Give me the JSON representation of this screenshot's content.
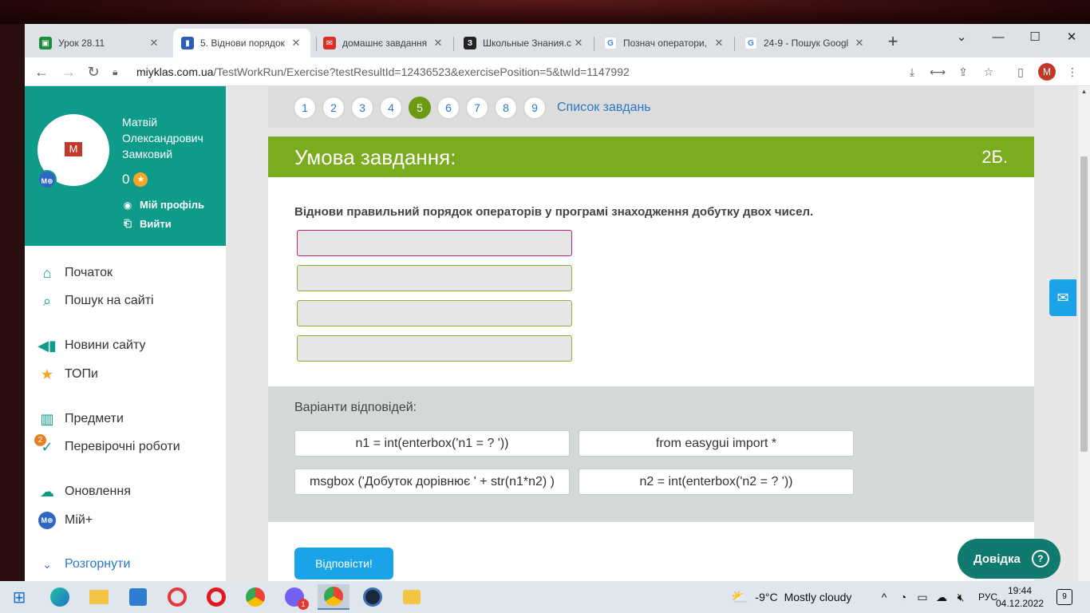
{
  "browser": {
    "tabs": [
      {
        "title": "Урок 28.11",
        "favicon": "classroom-icon"
      },
      {
        "title": "5. Віднови порядок",
        "favicon": "book-icon",
        "active": true
      },
      {
        "title": "домашнє завдання",
        "favicon": "gmail-icon"
      },
      {
        "title": "Школьные Знания.c",
        "favicon": "znanija-icon"
      },
      {
        "title": "Познач оператори,",
        "favicon": "google-icon"
      },
      {
        "title": "24-9 - Пошук Googl",
        "favicon": "google-icon"
      }
    ],
    "url_host": "miyklas.com.ua",
    "url_path": "/TestWorkRun/Exercise?testResultId=12436523&exercisePosition=5&twId=1147992",
    "profile_initial": "M"
  },
  "sidebar": {
    "avatar_initial": "M",
    "user_badge": "M⊕",
    "user_name": "Матвій Олександрович Замковий",
    "points": "0",
    "profile_link": "Мій профіль",
    "logout_link": "Вийти",
    "items": [
      {
        "label": "Початок",
        "icon": "home-icon"
      },
      {
        "label": "Пошук на сайті",
        "icon": "search-icon"
      },
      {
        "label": "Новини сайту",
        "icon": "megaphone-icon"
      },
      {
        "label": "ТОПи",
        "icon": "star-icon"
      },
      {
        "label": "Предмети",
        "icon": "books-icon"
      },
      {
        "label": "Перевірочні роботи",
        "icon": "check-icon",
        "badge": "2"
      },
      {
        "label": "Оновлення",
        "icon": "cloud-update-icon"
      },
      {
        "label": "Мій+",
        "icon": "mplus-icon"
      },
      {
        "label": "Розгорнути",
        "icon": "chevron-down-icon"
      }
    ]
  },
  "pager": {
    "pages": [
      "1",
      "2",
      "3",
      "4",
      "5",
      "6",
      "7",
      "8",
      "9"
    ],
    "current": "5",
    "tasks_link": "Список завдань"
  },
  "task": {
    "header_title": "Умова завдання:",
    "points": "2Б.",
    "question": "Віднови правильний порядок операторів у програмі  знаходження добутку двох чисел.",
    "answers_label": "Варіанти відповідей:",
    "options": [
      "n1 = int(enterbox('n1 = ? '))",
      "from easygui import *",
      "msgbox ('Добуток дорівнює ' + str(n1*n2) )",
      "n2 = int(enterbox('n2 = ? '))"
    ],
    "submit_label": "Відповісти!",
    "help_label": "Довідка"
  },
  "taskbar": {
    "weather_temp": "-9°C",
    "weather_text": "Mostly cloudy",
    "lang": "РУС",
    "time": "19:44",
    "date": "04.12.2022",
    "notifications": "9",
    "viber_badge": "1"
  },
  "colors": {
    "accent_green": "#7bab1e",
    "teal": "#0e9b8a",
    "link_blue": "#2979c4",
    "button_blue": "#1aa3e8"
  }
}
